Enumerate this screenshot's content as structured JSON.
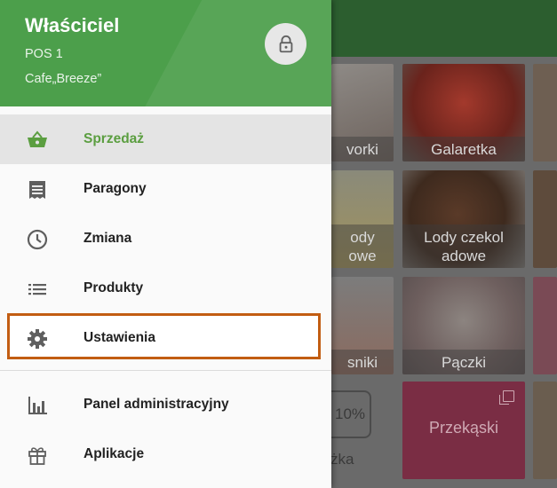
{
  "header": {
    "user": "Właściciel",
    "pos": "POS 1",
    "store": "Cafe„Breeze”"
  },
  "menu": {
    "items": [
      {
        "label": "Sprzedaż",
        "icon": "basket-icon"
      },
      {
        "label": "Paragony",
        "icon": "receipt-icon"
      },
      {
        "label": "Zmiana",
        "icon": "clock-icon"
      },
      {
        "label": "Produkty",
        "icon": "list-icon"
      },
      {
        "label": "Ustawienia",
        "icon": "gear-icon"
      },
      {
        "label": "Panel administracyjny",
        "icon": "bar-chart-icon"
      },
      {
        "label": "Aplikacje",
        "icon": "gift-icon"
      }
    ],
    "active_index": 0
  },
  "background": {
    "tiles": [
      {
        "label": "vorki"
      },
      {
        "label": "Galaretka"
      },
      {
        "label": "ody\nowe"
      },
      {
        "label": "Lody czekol\nadowe"
      },
      {
        "label": "sniki"
      },
      {
        "label": "Pączki"
      },
      {
        "label": "Przekąski"
      }
    ],
    "discount_label": "10%",
    "partial_label": "żka"
  },
  "colors": {
    "header": "#4c9f4b",
    "accent": "#5b9e40",
    "highlight_border": "#c25d12"
  }
}
